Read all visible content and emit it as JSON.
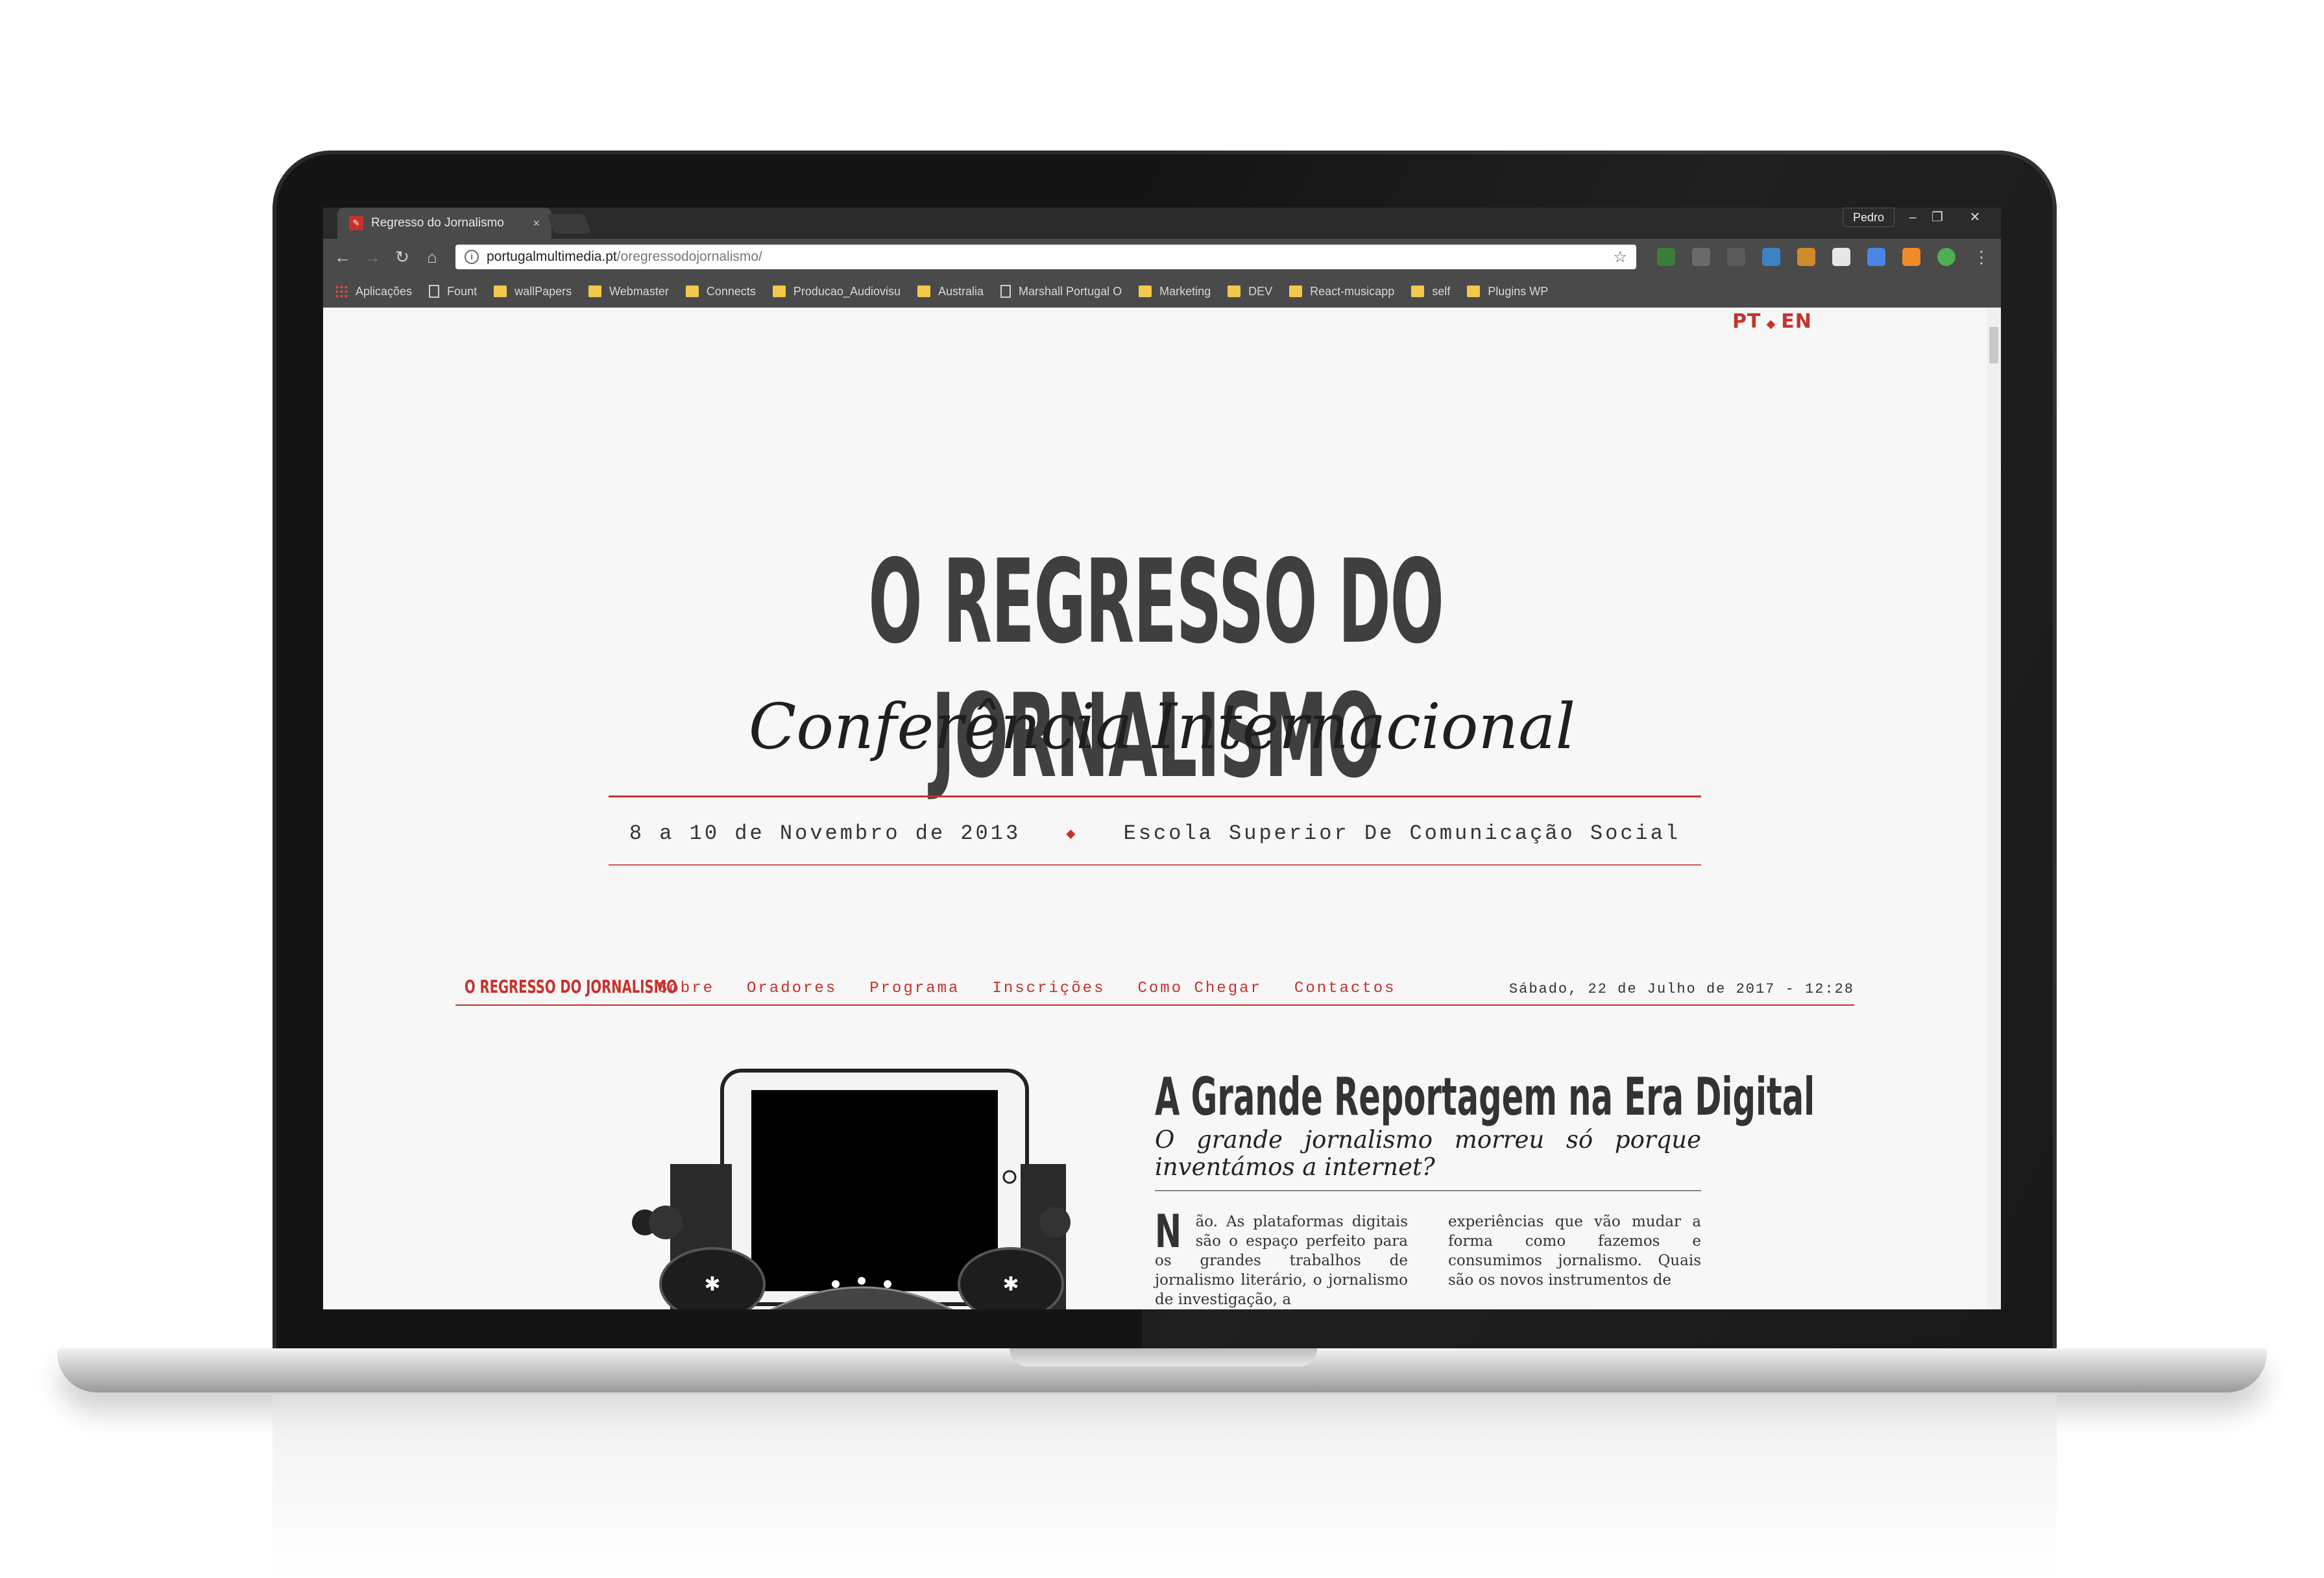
{
  "browser": {
    "tab_title": "Regresso do Jornalismo",
    "tab_close": "×",
    "profile_name": "Pedro",
    "window_controls": [
      "–",
      "❐",
      "✕"
    ],
    "url_host": "portugalmultimedia.pt",
    "url_path": "/oregressodojornalismo/",
    "bookmarks": [
      {
        "label": "Aplicações",
        "type": "apps"
      },
      {
        "label": "Fount",
        "type": "page"
      },
      {
        "label": "wallPapers",
        "type": "folder"
      },
      {
        "label": "Webmaster",
        "type": "folder"
      },
      {
        "label": "Connects",
        "type": "folder"
      },
      {
        "label": "Producao_Audiovisu",
        "type": "folder"
      },
      {
        "label": "Australia",
        "type": "folder"
      },
      {
        "label": "Marshall Portugal O",
        "type": "page"
      },
      {
        "label": "Marketing",
        "type": "folder"
      },
      {
        "label": "DEV",
        "type": "folder"
      },
      {
        "label": "React-musicapp",
        "type": "folder"
      },
      {
        "label": "self",
        "type": "folder"
      },
      {
        "label": "Plugins WP",
        "type": "folder"
      }
    ]
  },
  "page": {
    "lang_pt": "PT",
    "lang_sep": "◆",
    "lang_en": "EN",
    "headline": "O REGRESSO DO JORNALISMO",
    "subtitle": "Conferência Internacional",
    "date_text": "8 a 10 de Novembro de 2013",
    "date_sep": "◆",
    "venue_text": "Escola Superior De Comunicação Social",
    "nav_brand": "O REGRESSO DO JORNALISMO",
    "nav_items": [
      "Sobre",
      "Oradores",
      "Programa",
      "Inscrições",
      "Como Chegar",
      "Contactos"
    ],
    "nav_date": "Sábado, 22 de Julho de 2017 - 12:28",
    "article_title": "A Grande Reportagem na Era Digital",
    "article_lead": "O grande jornalismo morreu só porque inventámos a internet?",
    "dropcap": "N",
    "col1_text": "ão. As plataformas digitais são o espaço perfeito para os grandes trabalhos de jornalismo literário, o jornalismo de investigação, a",
    "col2_text": "experiências que vão mudar a forma como fazemos e consumimos jornalismo. Quais são os novos instrumentos de"
  },
  "colors": {
    "accent": "#c8312b",
    "text": "#333333",
    "chrome": "#4a4a4a"
  }
}
